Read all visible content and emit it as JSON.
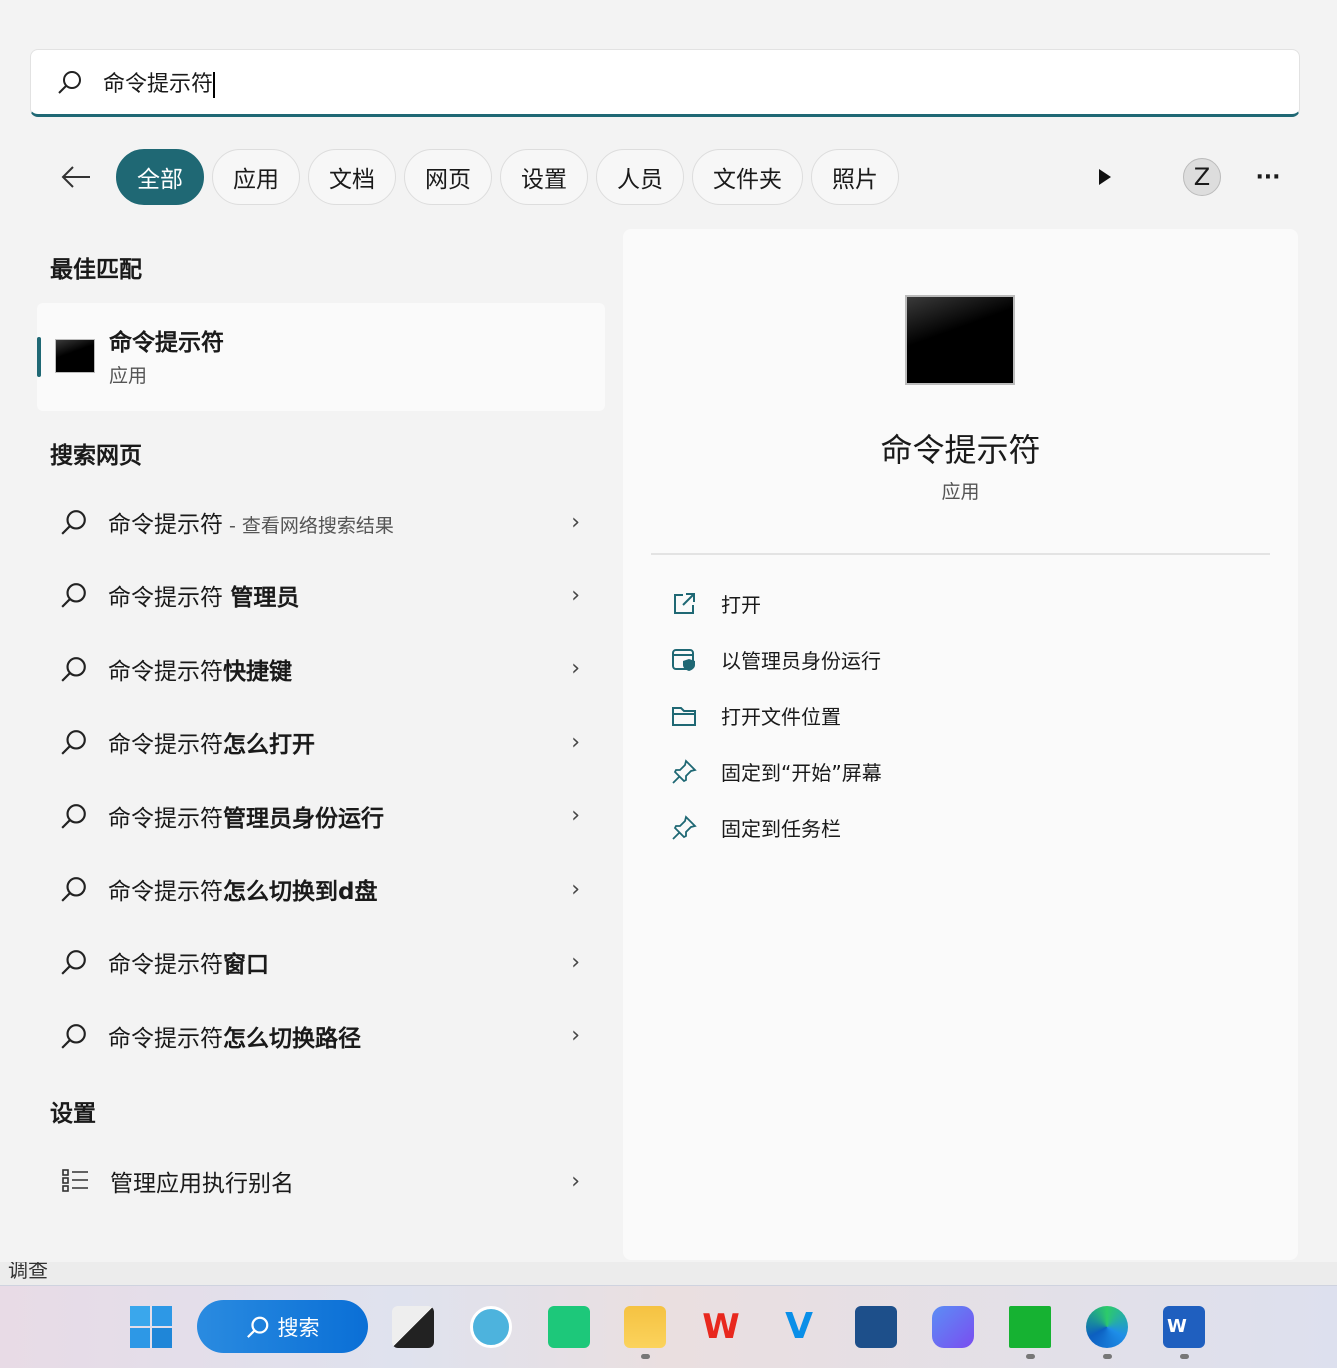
{
  "search": {
    "query": "命令提示符"
  },
  "filters": [
    "全部",
    "应用",
    "文档",
    "网页",
    "设置",
    "人员",
    "文件夹",
    "照片"
  ],
  "avatar": "Z",
  "best_match": {
    "heading": "最佳匹配",
    "name": "命令提示符",
    "type": "应用"
  },
  "web": {
    "heading": "搜索网页",
    "items": [
      {
        "prefix": "命令提示符",
        "bold": "",
        "sub": " - 查看网络搜索结果"
      },
      {
        "prefix": "命令提示符 ",
        "bold": "管理员",
        "sub": ""
      },
      {
        "prefix": "命令提示符",
        "bold": "快捷键",
        "sub": ""
      },
      {
        "prefix": "命令提示符",
        "bold": "怎么打开",
        "sub": ""
      },
      {
        "prefix": "命令提示符",
        "bold": "管理员身份运行",
        "sub": ""
      },
      {
        "prefix": "命令提示符",
        "bold": "怎么切换到d盘",
        "sub": ""
      },
      {
        "prefix": "命令提示符",
        "bold": "窗口",
        "sub": ""
      },
      {
        "prefix": "命令提示符",
        "bold": "怎么切换路径",
        "sub": ""
      }
    ]
  },
  "settings": {
    "heading": "设置",
    "items": [
      {
        "label": "管理应用执行别名"
      }
    ]
  },
  "detail": {
    "name": "命令提示符",
    "type": "应用",
    "actions": [
      "打开",
      "以管理员身份运行",
      "打开文件位置",
      "固定到“开始”屏幕",
      "固定到任务栏"
    ]
  },
  "behind_text": "调查",
  "taskbar": {
    "search_label": "搜索"
  }
}
